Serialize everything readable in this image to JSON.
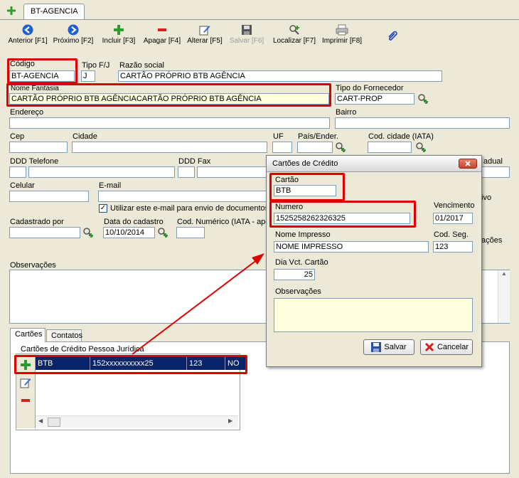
{
  "tab": {
    "title": "BT-AGENCIA"
  },
  "toolbar": [
    {
      "label": "Anterior [F1]",
      "icon": "arrow-left-icon",
      "enabled": true
    },
    {
      "label": "Próximo [F2]",
      "icon": "arrow-right-icon",
      "enabled": true
    },
    {
      "label": "Incluir [F3]",
      "icon": "plus-icon",
      "enabled": true
    },
    {
      "label": "Apagar [F4]",
      "icon": "minus-icon",
      "enabled": true
    },
    {
      "label": "Alterar [F5]",
      "icon": "edit-icon",
      "enabled": true
    },
    {
      "label": "Salvar [F6]",
      "icon": "save-icon",
      "enabled": false
    },
    {
      "label": "Localizar [F7]",
      "icon": "search-icon",
      "enabled": true
    },
    {
      "label": "Imprimir [F8]",
      "icon": "printer-icon",
      "enabled": true
    }
  ],
  "form": {
    "codigo": {
      "label": "Código",
      "value": "BT-AGENCIA"
    },
    "tipo_fj": {
      "label": "Tipo F/J",
      "value": "J"
    },
    "razao_social": {
      "label": "Razão social",
      "value": "CARTÃO PRÓPRIO BTB AGÊNCIA"
    },
    "nome_fantasia": {
      "label": "Nome Fantasia",
      "value": "CARTÃO PRÓPRIO BTB AGÊNCIACARTÃO PRÓPRIO BTB AGÊNCIA"
    },
    "tipo_fornecedor": {
      "label": "Tipo do Fornecedor",
      "value": "CART-PROP"
    },
    "endereco": {
      "label": "Endereço",
      "value": ""
    },
    "bairro": {
      "label": "Bairro",
      "value": ""
    },
    "cep": {
      "label": "Cep",
      "value": ""
    },
    "cidade": {
      "label": "Cidade",
      "value": ""
    },
    "uf": {
      "label": "UF",
      "value": ""
    },
    "pais": {
      "label": "País/Ender.",
      "value": ""
    },
    "cod_cidade": {
      "label": "Cod. cidade (IATA)",
      "value": ""
    },
    "ddd_telefone": {
      "label": "DDD Telefone",
      "value": ""
    },
    "ddd_fax": {
      "label": "DDD Fax",
      "value": ""
    },
    "estadual_partial": "adual",
    "celular": {
      "label": "Celular",
      "value": ""
    },
    "email": {
      "label": "E-mail",
      "value": ""
    },
    "ivo_partial": "ivo",
    "utilizar_email": {
      "label": "Utilizar este e-mail para envio de documentos",
      "checked": true
    },
    "cadastrado_por": {
      "label": "Cadastrado por",
      "value": ""
    },
    "data_cadastro": {
      "label": "Data do cadastro",
      "value": "10/10/2014"
    },
    "cod_numerico": {
      "label": "Cod. Numérico (IATA - ape",
      "value": ""
    },
    "acoes_partial": "ações",
    "observacoes": {
      "label": "Observações",
      "value": ""
    }
  },
  "bottom_tabs": [
    "Cartões",
    "Contatos"
  ],
  "cards_grid": {
    "title": "Cartões de Crédito Pessoa Jurídica",
    "row": [
      "BTB",
      "152xxxxxxxxxx25",
      "123",
      "NO"
    ]
  },
  "dialog": {
    "title": "Cartões de Crédito",
    "cartao": {
      "label": "Cartão",
      "value": "BTB"
    },
    "numero": {
      "label": "Numero",
      "value": "1525258262326325"
    },
    "vencimento": {
      "label": "Vencimento",
      "value": "01/2017"
    },
    "nome_impresso": {
      "label": "Nome Impresso",
      "value": "NOME IMPRESSO"
    },
    "cod_seg": {
      "label": "Cod. Seg.",
      "value": "123"
    },
    "dia_vct": {
      "label": "Dia Vct. Cartão",
      "value": "25"
    },
    "observacoes": {
      "label": "Observações",
      "value": ""
    },
    "save_label": "Salvar",
    "cancel_label": "Cancelar"
  }
}
